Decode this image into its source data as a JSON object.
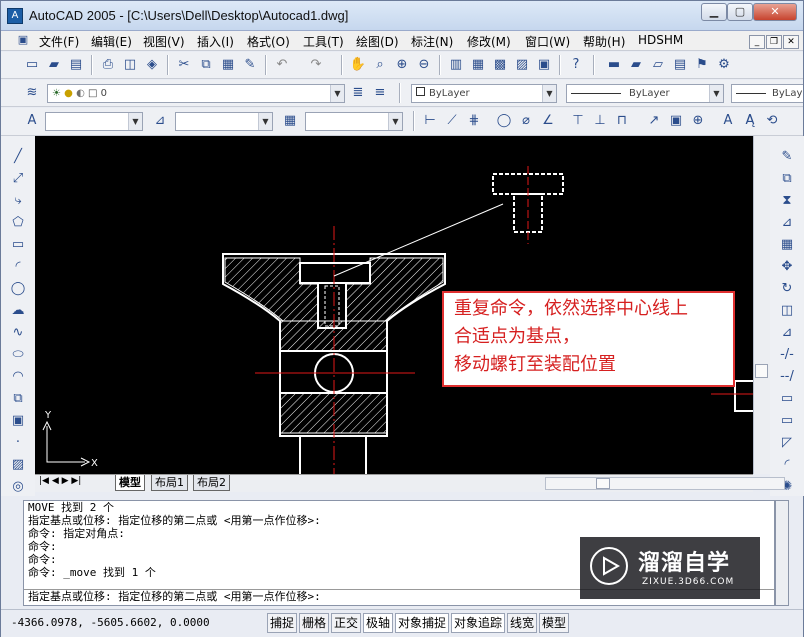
{
  "window": {
    "title": "AutoCAD 2005 - [C:\\Users\\Dell\\Desktop\\Autocad1.dwg]",
    "min_glyph": "▁",
    "max_glyph": "▢",
    "close_glyph": "✕",
    "icon_glyph": "A"
  },
  "menu": {
    "items": [
      "文件(F)",
      "编辑(E)",
      "视图(V)",
      "插入(I)",
      "格式(O)",
      "工具(T)",
      "绘图(D)",
      "标注(N)",
      "修改(M)",
      "窗口(W)",
      "帮助(H)",
      "HDSHM"
    ]
  },
  "layers": {
    "layer_value": "0",
    "color_value": "ByLayer",
    "linetype_value": "ByLayer",
    "lineweight_value": "ByLay"
  },
  "layout_tabs": [
    "模型",
    "布局1",
    "布局2"
  ],
  "ucs": {
    "x": "X",
    "y": "Y"
  },
  "command_lines": [
    "MOVE 找到 2 个",
    "指定基点或位移: 指定位移的第二点或 <用第一点作位移>:",
    "命令: 指定对角点:",
    "命令:",
    "命令:",
    "命令: _move 找到 1 个"
  ],
  "command_prompt": "指定基点或位移: 指定位移的第二点或 <用第一点作位移>:",
  "status": {
    "coords": "-4366.0978, -5605.6602, 0.0000",
    "toggles": [
      "捕捉",
      "栅格",
      "正交",
      "极轴",
      "对象捕捉",
      "对象追踪",
      "线宽",
      "模型"
    ]
  },
  "annotation": {
    "line1": "重复命令，依然选择中心线上",
    "line2": "合适点为基点，",
    "line3": "移动螺钉至装配位置"
  },
  "watermark": {
    "title": "溜溜自学",
    "url": "ZIXUE.3D66.COM"
  },
  "colors": {
    "canvas": "#000000",
    "drawing": "#ffffff",
    "centerline": "#e01818",
    "annotation": "#d62020"
  }
}
